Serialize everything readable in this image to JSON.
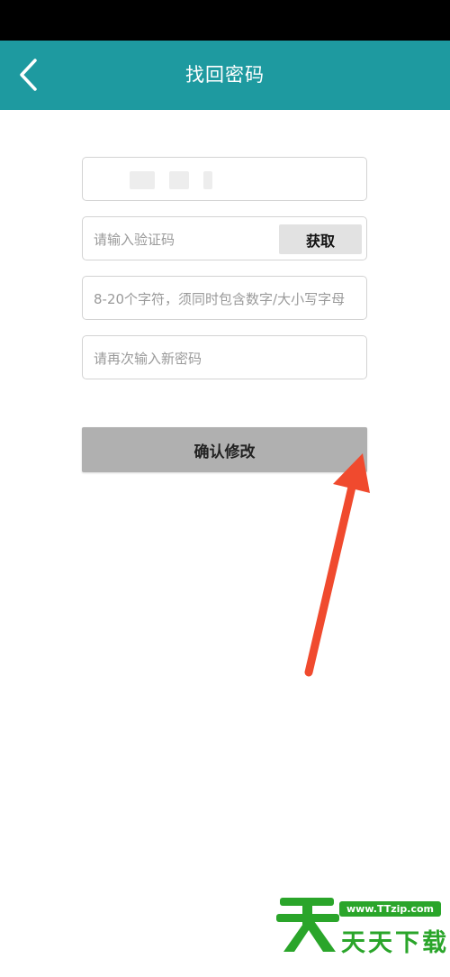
{
  "header": {
    "title": "找回密码",
    "back_icon": "chevron-left-icon"
  },
  "form": {
    "phone_value": "",
    "code_placeholder": "请输入验证码",
    "get_code_label": "获取",
    "new_password_placeholder": "8-20个字符，须同时包含数字/大小写字母",
    "confirm_password_placeholder": "请再次输入新密码",
    "submit_label": "确认修改"
  },
  "watermark": {
    "url": "www.TTzip.com",
    "brand": "天天下载"
  },
  "colors": {
    "nav_bar": "#1e9aa0",
    "submit_button": "#b0b0b0",
    "annotation_arrow": "#f04a2e",
    "watermark_green": "#2aa52a"
  }
}
